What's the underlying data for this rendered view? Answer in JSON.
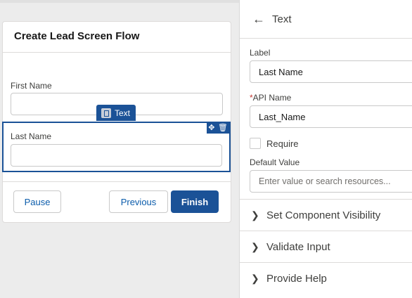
{
  "screen": {
    "title": "Create Lead Screen Flow",
    "fields": [
      {
        "label": "First Name",
        "value": ""
      },
      {
        "label": "Last Name",
        "value": ""
      }
    ],
    "selected_tag": "Text",
    "buttons": {
      "pause": "Pause",
      "previous": "Previous",
      "finish": "Finish"
    }
  },
  "panel": {
    "title": "Text",
    "label_label": "Label",
    "label_value": "Last Name",
    "api_star": "*",
    "api_label": "API Name",
    "api_value": "Last_Name",
    "require_label": "Require",
    "default_label": "Default Value",
    "default_placeholder": "Enter value or search resources...",
    "sections": [
      "Set Component Visibility",
      "Validate Input",
      "Provide Help"
    ]
  },
  "icons": {
    "back": "arrow-left-icon",
    "move": "move-icon",
    "delete": "trash-icon",
    "chevron": "chevron-right-icon"
  },
  "colors": {
    "brand": "#1b5297",
    "required": "#c23934"
  }
}
